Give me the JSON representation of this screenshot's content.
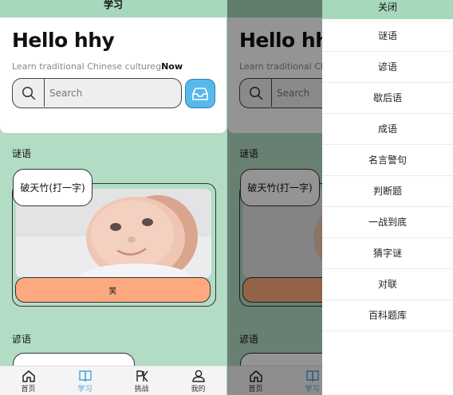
{
  "top_bar": {
    "title": "学习"
  },
  "header": {
    "greeting": "Hello hhy",
    "subtitle_prefix": "Learn traditional Chinese cultureg",
    "subtitle_bold": "Now"
  },
  "search": {
    "placeholder": "Search"
  },
  "sections": {
    "riddle_title": "谜语",
    "proverb_title": "谚语"
  },
  "riddle": {
    "question": "破天竹(打一字)",
    "answer_button": "笑"
  },
  "tabbar": {
    "items": [
      {
        "label": "首页",
        "icon": "home-icon"
      },
      {
        "label": "学习",
        "icon": "book-icon",
        "active": true
      },
      {
        "label": "挑战",
        "icon": "pk-icon"
      },
      {
        "label": "我的",
        "icon": "user-icon"
      }
    ]
  },
  "drawer": {
    "close_label": "关闭",
    "items": [
      "谜语",
      "谚语",
      "歇后语",
      "成语",
      "名言警句",
      "判断题",
      "一战到底",
      "猜字谜",
      "对联",
      "百科题库"
    ]
  },
  "colors": {
    "app_green": "#b3dcc5",
    "bar_green": "#a6d8bb",
    "answer_orange": "#fca97f",
    "inbox_blue": "#56b9ea",
    "active_tab": "#4aa3d8"
  }
}
